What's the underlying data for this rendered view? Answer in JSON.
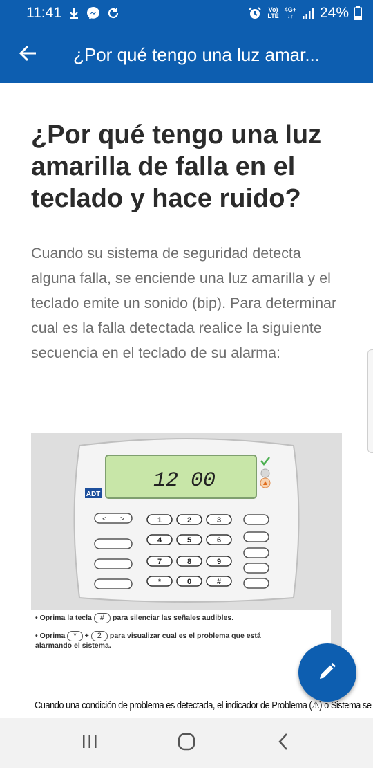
{
  "status_bar": {
    "time": "11:41",
    "volte_top": "Vo)",
    "volte_bottom": "LTE",
    "network_top": "4G+",
    "network_bottom": "↓↑",
    "battery": "24%",
    "icons": [
      "download-icon",
      "messenger-icon",
      "sync-icon",
      "alarm-icon",
      "signal-icon",
      "battery-icon"
    ]
  },
  "app_bar": {
    "title": "¿Por qué tengo una luz amar...",
    "back_icon": "arrow-left-icon"
  },
  "article": {
    "title": "¿Por qué tengo una luz amarilla de falla en el teclado y hace ruido?",
    "body": "Cuando su sistema de seguridad detecta alguna falla, se enciende una luz amarilla y el teclado emite un sonido (bip). Para determinar cual es la falla detectada realice la siguiente secuencia en el teclado de su alarma:",
    "keypad": {
      "display": "12 00",
      "brand": "ADT",
      "keys": [
        "1",
        "2",
        "3",
        "4",
        "5",
        "6",
        "7",
        "8",
        "9",
        "*",
        "0",
        "#"
      ],
      "caption": {
        "line1_prefix": "• Oprima la tecla",
        "line1_key": "#",
        "line1_suffix": "para silenciar las señales audibles.",
        "line2_prefix": "• Oprima",
        "line2_key1": "*",
        "line2_plus": "+",
        "line2_key2": "2",
        "line2_suffix": "para visualizar cual es el problema que está",
        "line3": "alarmando el sistema."
      }
    },
    "bottom_text": "Cuando una condición de problema es detectada, el indicador de Problema (⚠) o Sistema se"
  },
  "fab": {
    "icon": "pencil-icon"
  },
  "nav_bar": {
    "icons": [
      "recent-apps-icon",
      "home-icon",
      "back-icon"
    ]
  },
  "colors": {
    "primary": "#0d5eb0",
    "title_text": "#2b2b2b",
    "body_text": "#6e6e6e"
  }
}
